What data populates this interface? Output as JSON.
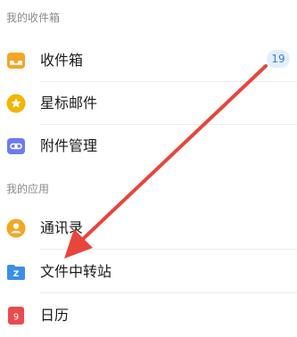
{
  "sections": {
    "mailbox_header": "我的收件箱",
    "apps_header": "我的应用"
  },
  "items": {
    "inbox": {
      "label": "收件箱",
      "icon": "inbox-tray-icon",
      "badge": "19",
      "icon_color": "#f5a623"
    },
    "starred": {
      "label": "星标邮件",
      "icon": "star-icon",
      "icon_color": "#f5b400"
    },
    "attachments": {
      "label": "附件管理",
      "icon": "attachment-link-icon",
      "icon_color": "#6a7cf0"
    },
    "contacts": {
      "label": "通讯录",
      "icon": "contacts-person-icon",
      "icon_color": "#f5a623"
    },
    "file_transfer": {
      "label": "文件中转站",
      "icon": "folder-z-icon",
      "icon_letter": "Z",
      "icon_color": "#3a8ee8"
    },
    "calendar": {
      "label": "日历",
      "icon": "calendar-icon",
      "icon_day": "9",
      "icon_color": "#e84c4c"
    }
  },
  "annotation": {
    "arrow_color": "#e8453c"
  }
}
